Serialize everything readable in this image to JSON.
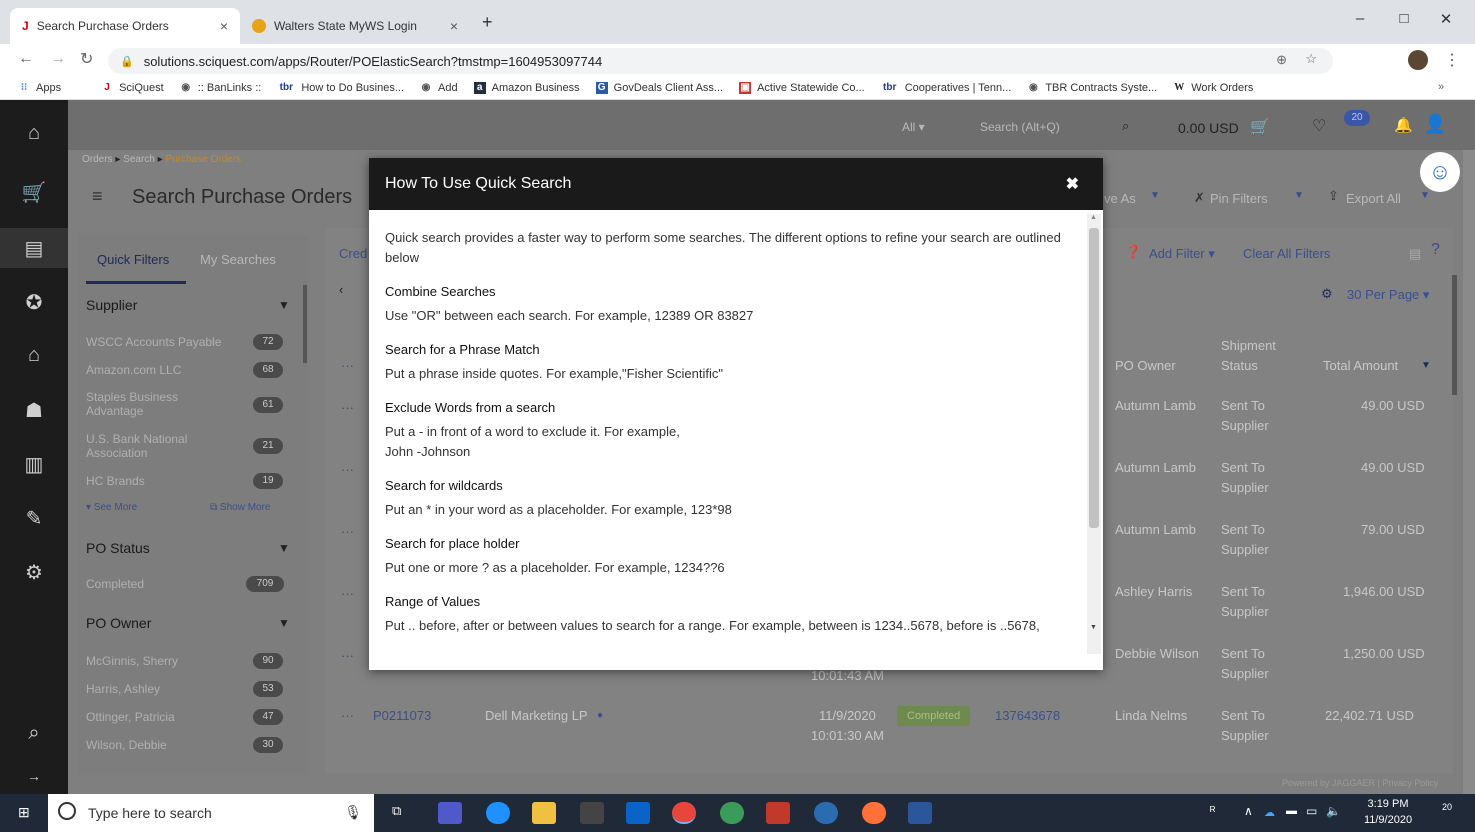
{
  "browser": {
    "tabs": [
      {
        "title": "Search Purchase Orders",
        "close": "×"
      },
      {
        "title": "Walters State MyWS Login",
        "close": "×"
      }
    ],
    "new_tab": "+",
    "window": {
      "minimize": "–",
      "maximize": "□",
      "close": "✕"
    },
    "url": "solutions.sciquest.com/apps/Router/POElasticSearch?tmstmp=1604953097744",
    "bookmarks": [
      "Apps",
      "SciQuest",
      ":: BanLinks ::",
      "How to Do Busines...",
      "Add",
      "Amazon Business",
      "GovDeals Client Ass...",
      "Active Statewide Co...",
      "Cooperatives | Tenn...",
      "TBR Contracts Syste...",
      "Work Orders"
    ],
    "bookmarks_more": "»"
  },
  "header": {
    "scope": "All ▾",
    "search_placeholder": "Search (Alt+Q)",
    "cart_total": "0.00 USD",
    "notification_count": "20"
  },
  "breadcrumb": [
    "Orders",
    "Search",
    "Purchase Orders"
  ],
  "page_title": "Search Purchase Orders",
  "toolbar": {
    "save_as": "ve As",
    "pin_filters": "Pin Filters",
    "export_all": "Export All"
  },
  "filters_toolbar": {
    "add_filter": "Add Filter ▾",
    "clear_all": "Clear All Filters"
  },
  "per_page": "30 Per Page ▾",
  "side_tabs": {
    "quick": "Quick Filters",
    "my": "My Searches"
  },
  "filters": {
    "supplier_title": "Supplier",
    "suppliers": [
      {
        "name": "WSCC Accounts Payable",
        "count": "72"
      },
      {
        "name": "Amazon.com LLC",
        "count": "68"
      },
      {
        "name": "Staples Business Advantage",
        "count": "61"
      },
      {
        "name": "U.S. Bank National Association",
        "count": "21"
      },
      {
        "name": "HC Brands",
        "count": "19"
      }
    ],
    "see_more": "See More",
    "show_more": "Show More",
    "po_status_title": "PO Status",
    "status": [
      {
        "name": "Completed",
        "count": "709"
      }
    ],
    "po_owner_title": "PO Owner",
    "owners": [
      {
        "name": "McGinnis, Sherry",
        "count": "90"
      },
      {
        "name": "Harris, Ashley",
        "count": "53"
      },
      {
        "name": "Ottinger, Patricia",
        "count": "47"
      },
      {
        "name": "Wilson, Debbie",
        "count": "30"
      }
    ]
  },
  "table": {
    "col_created": "Cred",
    "headers": {
      "owner": "PO Owner",
      "shipment": "Shipment Status",
      "total": "Total Amount"
    },
    "rows": [
      {
        "owner": "Autumn Lamb",
        "status": "Sent To Supplier",
        "total": "49.00 USD"
      },
      {
        "owner": "Autumn Lamb",
        "status": "Sent To Supplier",
        "total": "49.00 USD"
      },
      {
        "owner": "Autumn Lamb",
        "status": "Sent To Supplier",
        "total": "79.00 USD"
      },
      {
        "owner": "Ashley Harris",
        "status": "Sent To Supplier",
        "total": "1,946.00 USD"
      },
      {
        "owner": "Debbie Wilson",
        "status": "Sent To Supplier",
        "total": "1,250.00 USD"
      }
    ],
    "partial_time": "10:01:43 AM",
    "last_row": {
      "po": "P0211073",
      "supplier": "Dell Marketing LP",
      "date": "11/9/2020",
      "time": "10:01:30 AM",
      "status": "Completed",
      "req": "137643678",
      "owner": "Linda Nelms",
      "ship": "Sent To Supplier",
      "total": "22,402.71 USD"
    }
  },
  "footer": "Powered by JAGGAER | Privacy Policy",
  "modal": {
    "title": "How To Use Quick Search",
    "close": "✖",
    "intro": "Quick search provides a faster way to perform some searches. The different options to refine your search are outlined below",
    "sections": [
      {
        "title": "Combine Searches",
        "body": "Use \"OR\" between each search. For example, 12389 OR 83827"
      },
      {
        "title": "Search for a Phrase Match",
        "body": "Put a phrase inside quotes. For example,\"Fisher Scientific\""
      },
      {
        "title": "Exclude Words from a search",
        "body": "Put a - in front of a word to exclude it. For example,",
        "body2": "John -Johnson"
      },
      {
        "title": "Search for wildcards",
        "body": "Put an * in your word as a placeholder. For example, 123*98"
      },
      {
        "title": "Search for place holder",
        "body": "Put one or more ? as a placeholder. For example, 1234??6"
      },
      {
        "title": "Range of Values",
        "body": "Put .. before, after or between values to search for a range. For example, between is 1234..5678, before is ..5678,"
      }
    ]
  },
  "taskbar": {
    "search_placeholder": "Type here to search",
    "time": "3:19 PM",
    "date": "11/9/2020",
    "notif": "20"
  }
}
